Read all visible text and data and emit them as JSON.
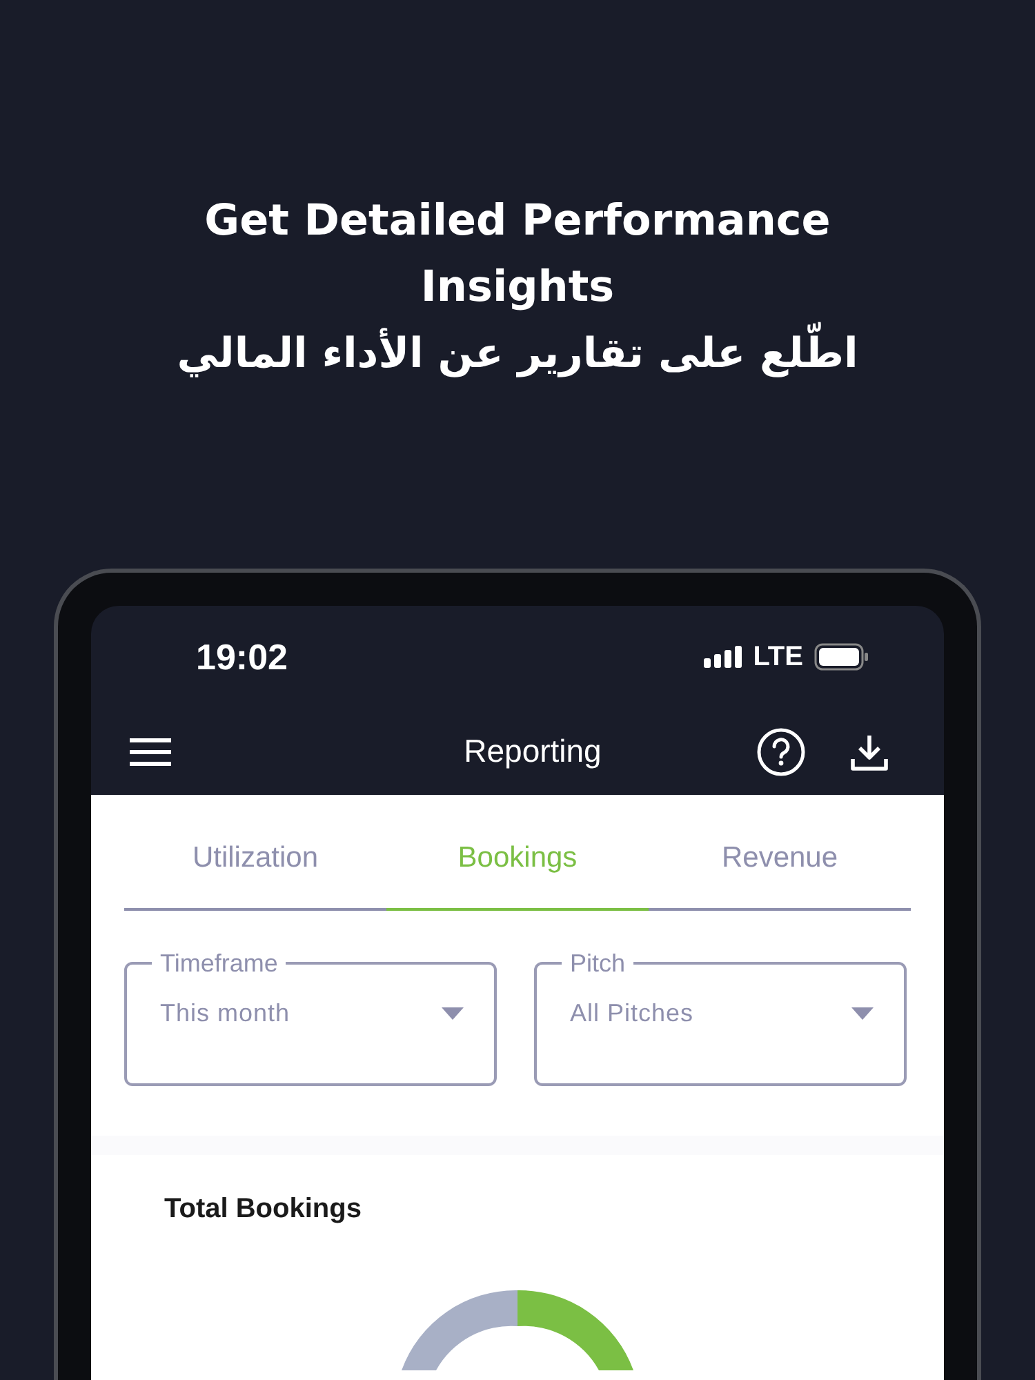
{
  "headline": "Get Detailed Performance Insights",
  "headline_ar": "اطّلع على تقارير عن الأداء المالي",
  "status_bar": {
    "time": "19:02",
    "network": "LTE"
  },
  "app_bar": {
    "title": "Reporting"
  },
  "tabs": [
    {
      "label": "Utilization",
      "selected": false
    },
    {
      "label": "Bookings",
      "selected": true
    },
    {
      "label": "Revenue",
      "selected": false
    }
  ],
  "filters": [
    {
      "label": "Timeframe",
      "value": "This month"
    },
    {
      "label": "Pitch",
      "value": "All Pitches"
    }
  ],
  "card": {
    "title": "Total Bookings"
  }
}
